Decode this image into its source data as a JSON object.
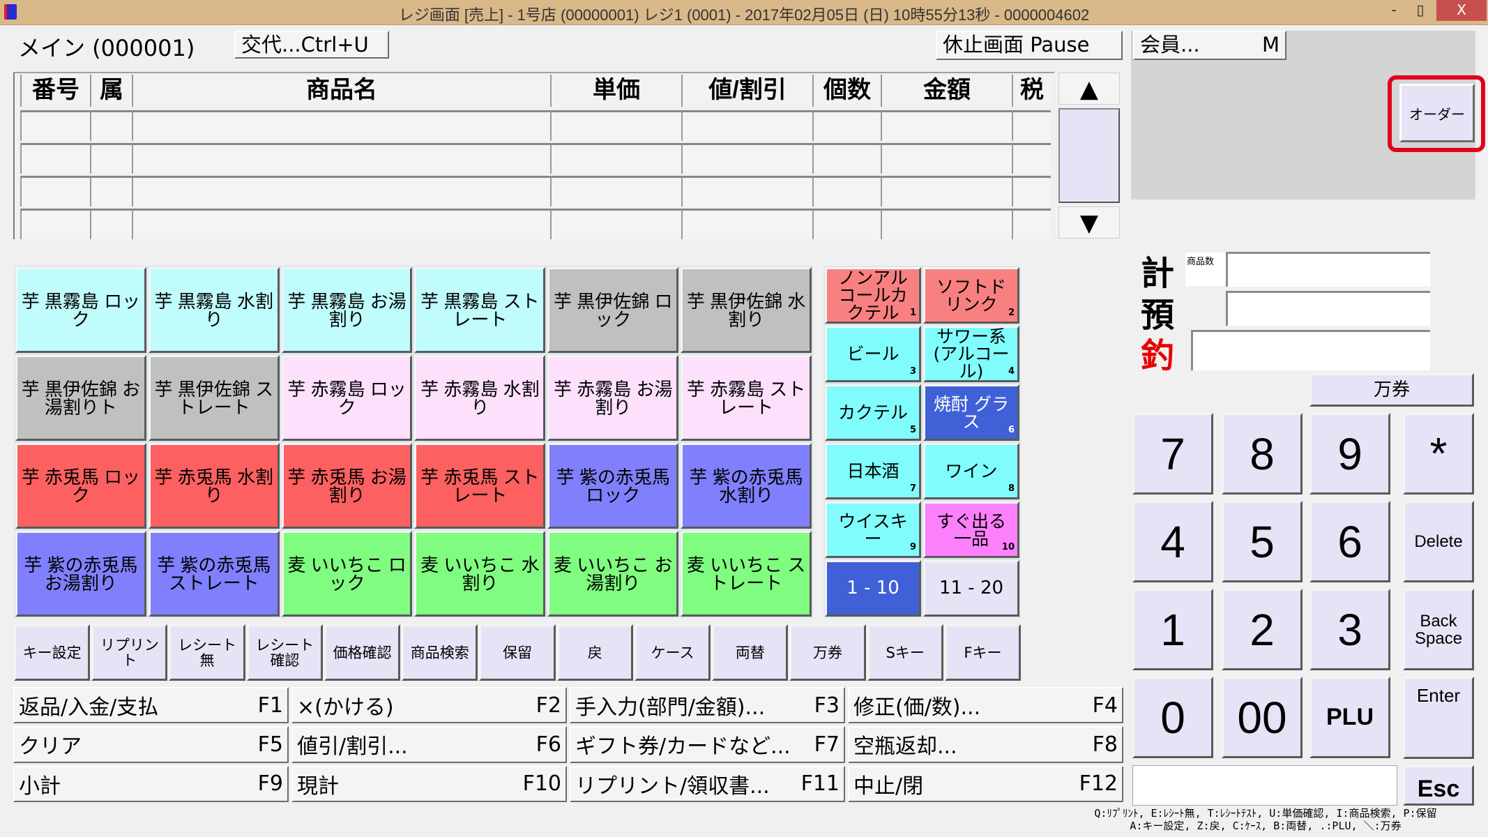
{
  "window": {
    "title": "レジ画面 [売上] - 1号店 (00000001) レジ1 (0001) - 2017年02月05日 (日) 10時55分13秒 - 0000004602",
    "minimize": "-",
    "maximize": "▯",
    "close": "X"
  },
  "header": {
    "main_label": "メイン (000001)",
    "shift_button": "交代...Ctrl+U",
    "pause_button": "休止画面 Pause",
    "member_button": "会員...",
    "member_key": "M",
    "order_button": "オーダー"
  },
  "table": {
    "columns": [
      "番号",
      "属",
      "商品名",
      "単価",
      "値/割引",
      "個数",
      "金額",
      "税"
    ],
    "rows": [
      [
        "",
        "",
        "",
        "",
        "",
        "",
        "",
        ""
      ],
      [
        "",
        "",
        "",
        "",
        "",
        "",
        "",
        ""
      ],
      [
        "",
        "",
        "",
        "",
        "",
        "",
        "",
        ""
      ],
      [
        "",
        "",
        "",
        "",
        "",
        "",
        "",
        ""
      ]
    ],
    "scroll_up": "▲",
    "scroll_down": "▼"
  },
  "products": [
    {
      "label": "芋 黒霧島 ロック",
      "color": "#c0fcfc"
    },
    {
      "label": "芋 黒霧島 水割り",
      "color": "#c0fcfc"
    },
    {
      "label": "芋 黒霧島 お湯割り",
      "color": "#c0fcfc"
    },
    {
      "label": "芋 黒霧島 ストレート",
      "color": "#c0fcfc"
    },
    {
      "label": "芋 黒伊佐錦 ロック",
      "color": "#c0c0c0"
    },
    {
      "label": "芋 黒伊佐錦 水割り",
      "color": "#c0c0c0"
    },
    {
      "label": "芋 黒伊佐錦 お湯割りト",
      "color": "#c0c0c0"
    },
    {
      "label": "芋 黒伊佐錦 ストレート",
      "color": "#c0c0c0"
    },
    {
      "label": "芋 赤霧島 ロック",
      "color": "#fce0fc"
    },
    {
      "label": "芋 赤霧島 水割り",
      "color": "#fce0fc"
    },
    {
      "label": "芋 赤霧島 お湯割り",
      "color": "#fce0fc"
    },
    {
      "label": "芋 赤霧島 ストレート",
      "color": "#fce0fc"
    },
    {
      "label": "芋 赤兎馬 ロック",
      "color": "#fc6060"
    },
    {
      "label": "芋 赤兎馬 水割り",
      "color": "#fc6060"
    },
    {
      "label": "芋 赤兎馬 お湯割り",
      "color": "#fc6060"
    },
    {
      "label": "芋 赤兎馬 ストレート",
      "color": "#fc6060"
    },
    {
      "label": "芋 紫の赤兎馬 ロック",
      "color": "#8080fc"
    },
    {
      "label": "芋 紫の赤兎馬 水割り",
      "color": "#8080fc"
    },
    {
      "label": "芋 紫の赤兎馬 お湯割り",
      "color": "#8080fc"
    },
    {
      "label": "芋 紫の赤兎馬 ストレート",
      "color": "#8080fc"
    },
    {
      "label": "麦 いいちこ ロック",
      "color": "#80fc80"
    },
    {
      "label": "麦 いいちこ 水割り",
      "color": "#80fc80"
    },
    {
      "label": "麦 いいちこ お湯割り",
      "color": "#80fc80"
    },
    {
      "label": "麦 いいちこ ストレート",
      "color": "#80fc80"
    }
  ],
  "categories": [
    {
      "label": "ノンアルコールカクテル",
      "num": "1",
      "color": "#f88080",
      "text": "#000000"
    },
    {
      "label": "ソフトドリンク",
      "num": "2",
      "color": "#f88080",
      "text": "#000000"
    },
    {
      "label": "ビール",
      "num": "3",
      "color": "#80fcfc",
      "text": "#000000"
    },
    {
      "label": "サワー系(アルコール)",
      "num": "4",
      "color": "#80fcfc",
      "text": "#000000"
    },
    {
      "label": "カクテル",
      "num": "5",
      "color": "#80fcfc",
      "text": "#000000"
    },
    {
      "label": "焼酎 グラス",
      "num": "6",
      "color": "#4060d8",
      "text": "#ffffff"
    },
    {
      "label": "日本酒",
      "num": "7",
      "color": "#80fcfc",
      "text": "#000000"
    },
    {
      "label": "ワイン",
      "num": "8",
      "color": "#80fcfc",
      "text": "#000000"
    },
    {
      "label": "ウイスキー",
      "num": "9",
      "color": "#80fcfc",
      "text": "#000000"
    },
    {
      "label": "すぐ出る一品",
      "num": "10",
      "color": "#fc80fc",
      "text": "#000000"
    }
  ],
  "pages": [
    {
      "label": "1 - 10",
      "color": "#4060d8",
      "text": "#ffffff",
      "active": true
    },
    {
      "label": "11 - 20",
      "color": "#e4e4f6",
      "text": "#000000",
      "active": false
    }
  ],
  "function_row": [
    "キー設定",
    "リプリント",
    "レシート無",
    "レシート確認",
    "価格確認",
    "商品検索",
    "保留",
    "戻",
    "ケース",
    "両替",
    "万券",
    "Sキー",
    "Fキー"
  ],
  "fkeys": [
    {
      "label": "返品/入金/支払",
      "key": "F1"
    },
    {
      "label": "×(かける)",
      "key": "F2"
    },
    {
      "label": "手入力(部門/金額)...",
      "key": "F3"
    },
    {
      "label": "修正(価/数)...",
      "key": "F4"
    },
    {
      "label": "クリア",
      "key": "F5"
    },
    {
      "label": "値引/割引...",
      "key": "F6"
    },
    {
      "label": "ギフト券/カードなど...",
      "key": "F7"
    },
    {
      "label": "空瓶返却...",
      "key": "F8"
    },
    {
      "label": "小計",
      "key": "F9"
    },
    {
      "label": "現計",
      "key": "F10"
    },
    {
      "label": "リプリント/領収書...",
      "key": "F11"
    },
    {
      "label": "中止/閉",
      "key": "F12"
    }
  ],
  "totals": {
    "total_label": "計",
    "count_label": "商品数",
    "deposit_label": "預",
    "change_label": "釣",
    "change_color": "#e80000",
    "total_value": "",
    "deposit_value": "",
    "change_value": ""
  },
  "numpad": {
    "man_button": "万券",
    "keys": [
      "7",
      "8",
      "9",
      "4",
      "5",
      "6",
      "1",
      "2",
      "3",
      "0",
      "00",
      "PLU"
    ],
    "asterisk": "*",
    "delete": "Delete",
    "backspace": "Back Space",
    "enter": "Enter",
    "esc": "Esc",
    "entry_value": ""
  },
  "hints": {
    "line1": "Q:ﾘﾌﾟﾘﾝﾄ, E:ﾚｼｰﾄ無, T:ﾚｼｰﾄﾃｽﾄ, U:単価確認, I:商品検索, P:保留",
    "line2": "A:キー設定, Z:戻, C:ｹｰｽ, B:両替, .:PLU, ＼:万券"
  }
}
